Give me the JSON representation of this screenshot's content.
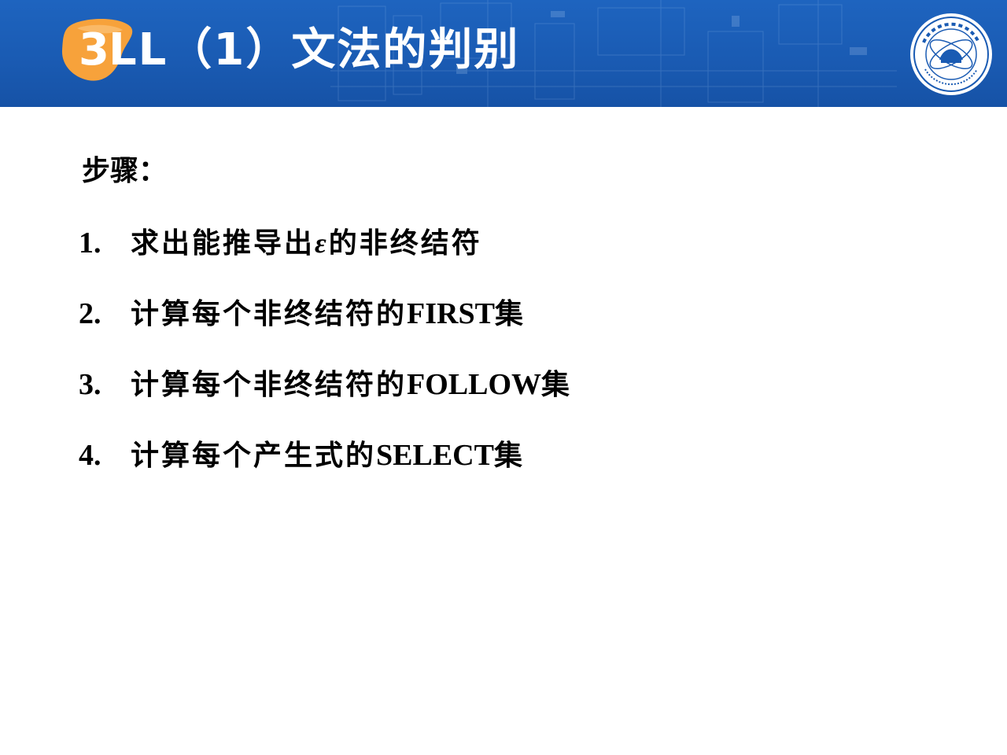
{
  "header": {
    "title_number": "3",
    "title_text": "LL（1）文法的判别",
    "colors": {
      "band": "#1a5bb3",
      "accent": "#f7a23b",
      "title_text": "#ffffff"
    },
    "logo_icon": "university-seal-icon"
  },
  "body": {
    "heading": "步骤：",
    "steps": [
      {
        "number": "1.",
        "text_before": "求出能推导出",
        "symbol": "ε",
        "text_after": "的非终结符"
      },
      {
        "number": "2.",
        "text_before": "计算每个非终结符的",
        "latin": "FIRST",
        "text_after": "集"
      },
      {
        "number": "3.",
        "text_before": "计算每个非终结符的",
        "latin": "FOLLOW",
        "text_after": "集"
      },
      {
        "number": "4.",
        "text_before": "计算每个产生式的",
        "latin": "SELECT",
        "text_after": "集"
      }
    ]
  }
}
